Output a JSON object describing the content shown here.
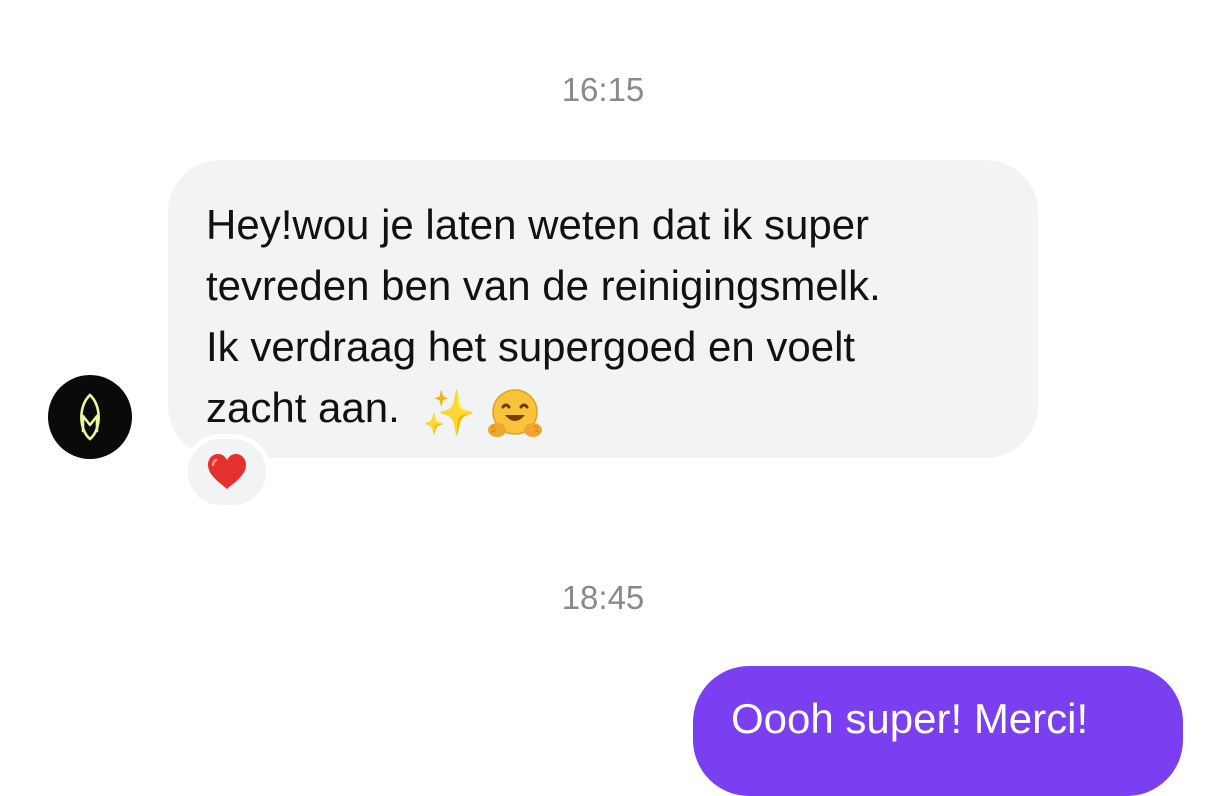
{
  "conversation": {
    "timestamps": [
      "16:15",
      "18:45"
    ],
    "incoming_message": {
      "text": "Hey!wou je laten weten dat ik super\ntevreden ben van de reinigingsmelk.\nIk verdraag het supergoed en voelt\nzacht aan.",
      "emojis": [
        "sparkles-emoji",
        "hugging-face-emoji"
      ],
      "reaction": "heart-emoji"
    },
    "outgoing_message": {
      "text": "Oooh super! Merci!"
    },
    "avatar_icon": "leaf-logo-icon"
  },
  "colors": {
    "incoming_bubble": "#f2f3f5",
    "outgoing_bubble": "#7b3ff2",
    "timestamp": "#8a8a8e",
    "avatar_bg": "#0a0a0a",
    "avatar_logo": "#e7f7a0",
    "heart": "#e5312e"
  }
}
